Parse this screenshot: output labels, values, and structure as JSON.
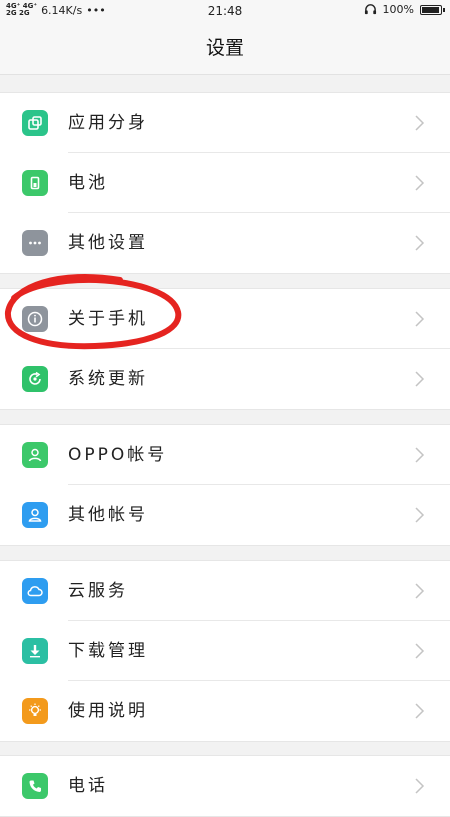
{
  "status_bar": {
    "network_top": "4G⁺ 4G⁺",
    "network_bottom": "2G 2G",
    "speed": "6.14K/s",
    "dots": "•••",
    "time": "21:48",
    "battery": "100%",
    "battery_level": 1.0
  },
  "header": {
    "title": "设置"
  },
  "groups": [
    {
      "items": [
        {
          "label": "应用分身",
          "icon": "app-clone-icon",
          "color": "#2bc48a"
        },
        {
          "label": "电池",
          "icon": "battery-icon",
          "color": "#3cc86a"
        },
        {
          "label": "其他设置",
          "icon": "more-icon",
          "color": "#8e949c"
        }
      ]
    },
    {
      "items": [
        {
          "label": "关于手机",
          "icon": "info-icon",
          "color": "#8e949c"
        },
        {
          "label": "系统更新",
          "icon": "update-icon",
          "color": "#2fc26a"
        }
      ]
    },
    {
      "items": [
        {
          "label": "OPPO帐号",
          "icon": "user-icon",
          "color": "#3cc86a"
        },
        {
          "label": "其他帐号",
          "icon": "person-icon",
          "color": "#2e9df0"
        }
      ]
    },
    {
      "items": [
        {
          "label": "云服务",
          "icon": "cloud-icon",
          "color": "#2e9df0"
        },
        {
          "label": "下载管理",
          "icon": "download-icon",
          "color": "#2bbfa3"
        },
        {
          "label": "使用说明",
          "icon": "bulb-icon",
          "color": "#f39a1c"
        }
      ]
    },
    {
      "items": [
        {
          "label": "电话",
          "icon": "phone-icon",
          "color": "#3cc86a"
        }
      ]
    }
  ],
  "annotation": {
    "color": "#e52420"
  }
}
